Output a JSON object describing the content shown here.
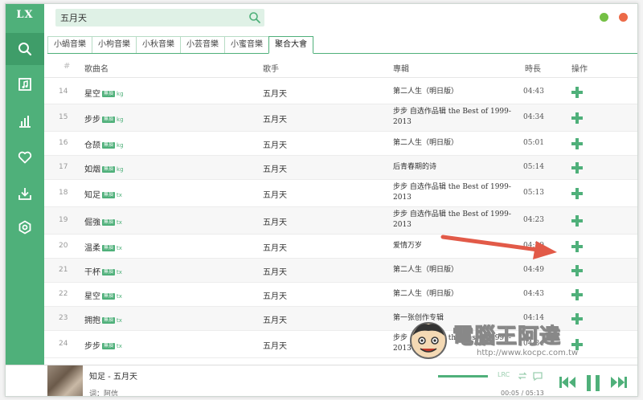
{
  "app": {
    "logo": "LX"
  },
  "search": {
    "value": "五月天",
    "placeholder": ""
  },
  "sidebar": {
    "items": [
      {
        "icon": "search-icon",
        "active": true
      },
      {
        "icon": "music-list-icon",
        "active": false
      },
      {
        "icon": "chart-icon",
        "active": false
      },
      {
        "icon": "heart-icon",
        "active": false
      },
      {
        "icon": "download-icon",
        "active": false
      },
      {
        "icon": "settings-icon",
        "active": false
      }
    ]
  },
  "window_controls": {
    "minimize_color": "#74c045",
    "close_color": "#ec6a48"
  },
  "tabs": [
    {
      "label": "小蝸音樂",
      "active": false
    },
    {
      "label": "小枸音樂",
      "active": false
    },
    {
      "label": "小秋音樂",
      "active": false
    },
    {
      "label": "小芸音樂",
      "active": false
    },
    {
      "label": "小蜜音樂",
      "active": false
    },
    {
      "label": "聚合大會",
      "active": true
    }
  ],
  "table": {
    "headers": {
      "num": "#",
      "name": "歌曲名",
      "singer": "歌手",
      "album": "專輯",
      "duration": "時長",
      "actions": "操作"
    },
    "rows": [
      {
        "num": "14",
        "name": "星空",
        "badge": "無損",
        "source": "kg",
        "singer": "五月天",
        "album": "第二人生（明日版）",
        "duration": "04:43"
      },
      {
        "num": "15",
        "name": "步步",
        "badge": "無損",
        "source": "kg",
        "singer": "五月天",
        "album": "步步 自选作品辑 the Best of 1999-2013",
        "duration": "04:34"
      },
      {
        "num": "16",
        "name": "仓颉",
        "badge": "無損",
        "source": "kg",
        "singer": "五月天",
        "album": "第二人生（明日版）",
        "duration": "05:01"
      },
      {
        "num": "17",
        "name": "如烟",
        "badge": "無損",
        "source": "kg",
        "singer": "五月天",
        "album": "后青春期的诗",
        "duration": "05:14"
      },
      {
        "num": "18",
        "name": "知足",
        "badge": "無損",
        "source": "tx",
        "singer": "五月天",
        "album": "步步 自选作品辑 the Best of 1999-2013",
        "duration": "05:13"
      },
      {
        "num": "19",
        "name": "倔強",
        "badge": "無損",
        "source": "tx",
        "singer": "五月天",
        "album": "步步 自选作品辑 the Best of 1999-2013",
        "duration": "04:23"
      },
      {
        "num": "20",
        "name": "温柔",
        "badge": "無損",
        "source": "tx",
        "singer": "五月天",
        "album": "爱情万岁",
        "duration": "04:29"
      },
      {
        "num": "21",
        "name": "干杯",
        "badge": "無損",
        "source": "tx",
        "singer": "五月天",
        "album": "第二人生（明日版）",
        "duration": "04:49"
      },
      {
        "num": "22",
        "name": "星空",
        "badge": "無損",
        "source": "tx",
        "singer": "五月天",
        "album": "第二人生（明日版）",
        "duration": "04:43"
      },
      {
        "num": "23",
        "name": "拥抱",
        "badge": "無損",
        "source": "tx",
        "singer": "五月天",
        "album": "第一张创作专辑",
        "duration": "04:14"
      },
      {
        "num": "24",
        "name": "步步",
        "badge": "無損",
        "source": "tx",
        "singer": "五月天",
        "album": "步步 自选作品辑 the Best of 1999-2013",
        "duration": "04:34"
      }
    ]
  },
  "player": {
    "title": "知足 - 五月天",
    "lyric": "词：阿信",
    "lrc_label": "LRC",
    "time": "00:05 / 05:13",
    "accent": "#4fb07a"
  },
  "watermark": {
    "text": "電腦王阿達",
    "url": "http://www.kocpc.com.tw"
  }
}
